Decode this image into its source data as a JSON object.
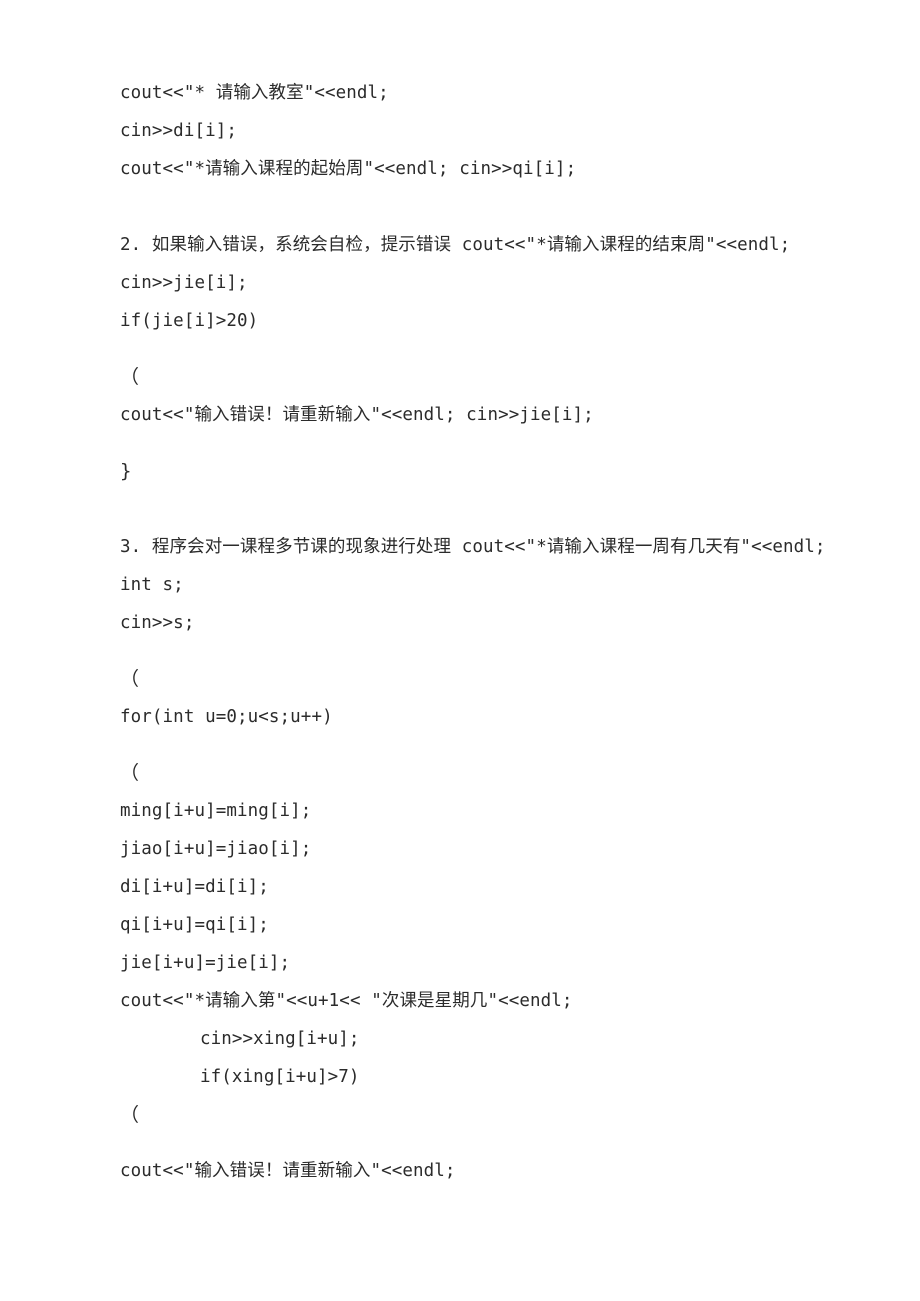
{
  "document": {
    "page_background": "#ffffff",
    "text_color": "#2b2b2b",
    "lines": [
      {
        "id": "l01",
        "text": "cout<<\"* 请输入教室\"<<endl;"
      },
      {
        "id": "l02",
        "text": "cin>>di[i];"
      },
      {
        "id": "l03",
        "text": "cout<<\"*请输入课程的起始周\"<<endl; cin>>qi[i];"
      },
      {
        "id": "l04",
        "text": "2. 如果输入错误，系统会自检，提示错误 cout<<\"*请输入课程的结束周\"<<endl;"
      },
      {
        "id": "l05",
        "text": "cin>>jie[i];"
      },
      {
        "id": "l06",
        "text": "if(jie[i]>20)"
      },
      {
        "id": "l07",
        "text": "（"
      },
      {
        "id": "l08",
        "text": "cout<<\"输入错误！请重新输入\"<<endl; cin>>jie[i];"
      },
      {
        "id": "l09",
        "text": "}"
      },
      {
        "id": "l10",
        "text": "3. 程序会对一课程多节课的现象进行处理 cout<<\"*请输入课程一周有几天有\"<<endl;"
      },
      {
        "id": "l11",
        "text": "int s;"
      },
      {
        "id": "l12",
        "text": "cin>>s;"
      },
      {
        "id": "l13",
        "text": "（"
      },
      {
        "id": "l14",
        "text": "for(int u=0;u<s;u++)"
      },
      {
        "id": "l15",
        "text": "（"
      },
      {
        "id": "l16",
        "text": "ming[i+u]=ming[i];"
      },
      {
        "id": "l17",
        "text": "jiao[i+u]=jiao[i];"
      },
      {
        "id": "l18",
        "text": "di[i+u]=di[i];"
      },
      {
        "id": "l19",
        "text": "qi[i+u]=qi[i];"
      },
      {
        "id": "l20",
        "text": "jie[i+u]=jie[i];"
      },
      {
        "id": "l21",
        "text": "cout<<\"*请输入第\"<<u+1<< \"次课是星期几\"<<endl;"
      },
      {
        "id": "l22",
        "text": "cin>>xing[i+u];"
      },
      {
        "id": "l23",
        "text": "if(xing[i+u]>7)"
      },
      {
        "id": "l24",
        "text": "（"
      },
      {
        "id": "l25",
        "text": "cout<<\"输入错误！请重新输入\"<<endl;"
      }
    ]
  }
}
